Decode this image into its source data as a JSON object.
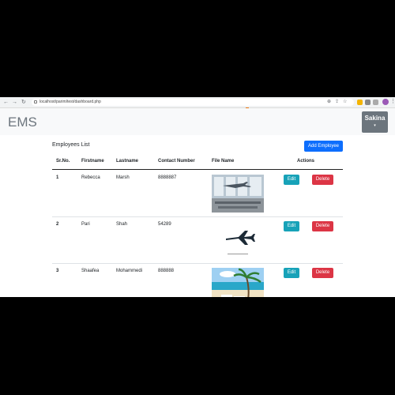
{
  "browser": {
    "url": "localhost/parim/test/dashboard.php"
  },
  "navbar": {
    "brand": "EMS",
    "user_name": "Sakina",
    "caret": "▾"
  },
  "main": {
    "list_title": "Employees List",
    "add_button": "Add Employee",
    "columns": [
      "Sr.No.",
      "Firstname",
      "Lastname",
      "Contact Number",
      "File Name",
      "Actions"
    ],
    "rows": [
      {
        "sr": "1",
        "first": "Rebecca",
        "last": "Marsh",
        "contact": "8888887",
        "file": "airport-terminal-image"
      },
      {
        "sr": "2",
        "first": "Pari",
        "last": "Shah",
        "contact": "54289",
        "file": "airplane-icon-image"
      },
      {
        "sr": "3",
        "first": "Shaafea",
        "last": "Mohammedi",
        "contact": "888888",
        "file": "beach-image"
      }
    ],
    "edit_label": "Edit",
    "delete_label": "Delete"
  },
  "colors": {
    "primary": "#0d6efd",
    "edit": "#17a2b8",
    "delete": "#dc3545",
    "user_button": "#6c757d"
  }
}
